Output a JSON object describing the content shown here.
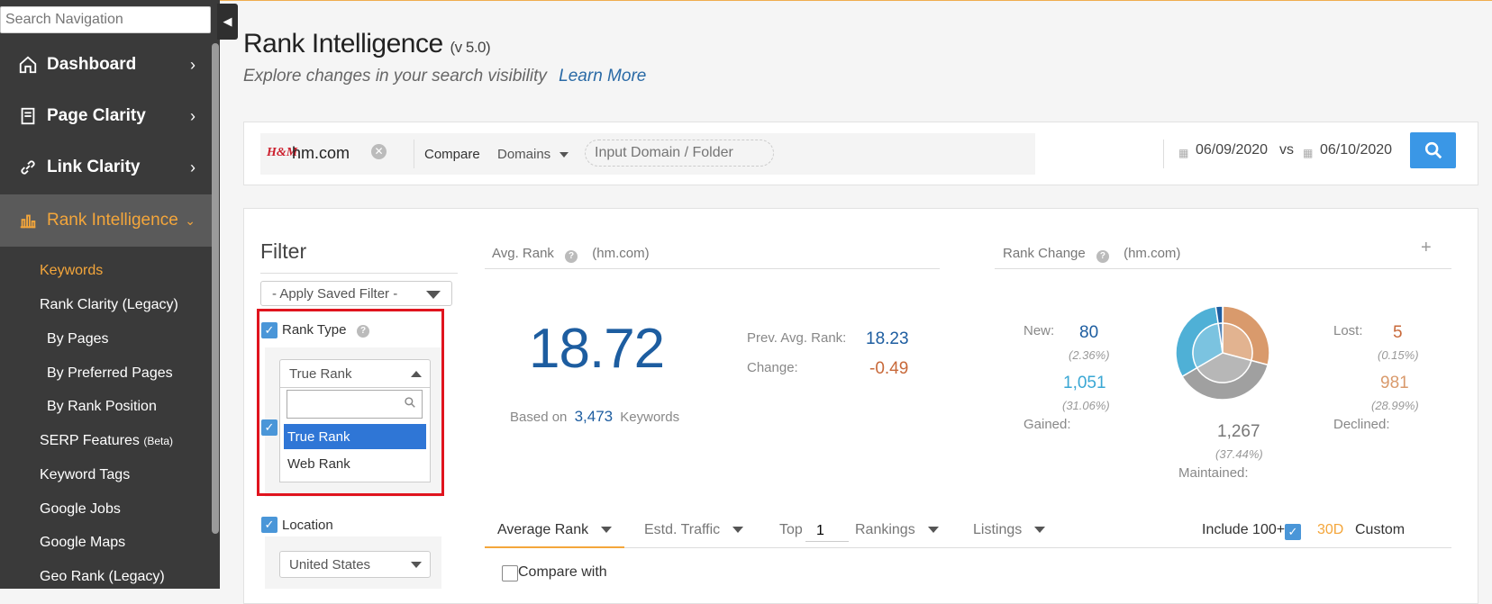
{
  "sidebar": {
    "search_placeholder": "Search Navigation",
    "main_items": [
      {
        "label": "Dashboard"
      },
      {
        "label": "Page Clarity"
      },
      {
        "label": "Link Clarity"
      },
      {
        "label": "Rank Intelligence"
      }
    ],
    "sub_items": [
      {
        "label": "Keywords"
      },
      {
        "label": "Rank Clarity (Legacy)"
      },
      {
        "label": "By Pages"
      },
      {
        "label": "By Preferred Pages"
      },
      {
        "label": "By Rank Position"
      },
      {
        "label": "SERP Features",
        "badge": "(Beta)"
      },
      {
        "label": "Keyword Tags"
      },
      {
        "label": "Google Jobs"
      },
      {
        "label": "Google Maps"
      },
      {
        "label": "Geo Rank (Legacy)"
      }
    ]
  },
  "header": {
    "title": "Rank Intelligence",
    "version": "(v 5.0)",
    "subtitle": "Explore changes in your search visibility",
    "learn_more": "Learn More"
  },
  "search_bar": {
    "brand_logo": "H&M",
    "domain": "hm.com",
    "compare_label": "Compare",
    "compare_type": "Domains",
    "domain_input_placeholder": "Input Domain / Folder",
    "date_from": "06/09/2020",
    "vs_label": "vs",
    "date_to": "06/10/2020"
  },
  "filter": {
    "title": "Filter",
    "saved_filter": "- Apply Saved Filter -",
    "rank_type_label": "Rank Type",
    "rank_type_value": "True Rank",
    "rank_type_options": [
      "True Rank",
      "Web Rank"
    ],
    "location_label": "Location",
    "location_value": "United States"
  },
  "avg_rank": {
    "header": "Avg. Rank",
    "domain": "(hm.com)",
    "value": "18.72",
    "prev_label": "Prev. Avg. Rank:",
    "prev_value": "18.23",
    "change_label": "Change:",
    "change_value": "-0.49",
    "based_on_label": "Based on",
    "keywords_count": "3,473",
    "keywords_label": "Keywords"
  },
  "rank_change": {
    "header": "Rank Change",
    "domain": "(hm.com)",
    "new_label": "New:",
    "new_value": "80",
    "new_pct": "(2.36%)",
    "gained_value": "1,051",
    "gained_pct": "(31.06%)",
    "gained_label": "Gained:",
    "maintained_value": "1,267",
    "maintained_pct": "(37.44%)",
    "maintained_label": "Maintained:",
    "lost_label": "Lost:",
    "lost_value": "5",
    "lost_pct": "(0.15%)",
    "declined_value": "981",
    "declined_pct": "(28.99%)",
    "declined_label": "Declined:",
    "colors": {
      "new": "#1d5da0",
      "gained": "#4fb0d6",
      "maintained": "#a0a0a0",
      "declined": "#d99a6c",
      "lost": "#c8693a"
    }
  },
  "tabs": {
    "average_rank": "Average Rank",
    "estd_traffic": "Estd. Traffic",
    "top_label": "Top",
    "top_value": "1",
    "rankings": "Rankings",
    "listings": "Listings",
    "include_100": "Include 100+",
    "range_30d": "30D",
    "custom": "Custom",
    "compare_with": "Compare with"
  }
}
